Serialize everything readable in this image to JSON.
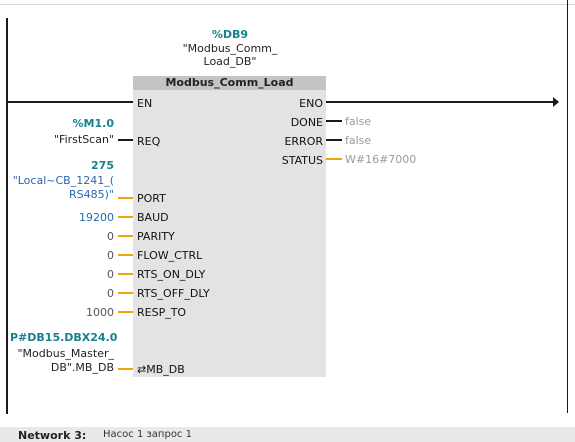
{
  "db": {
    "name": "%DB9",
    "symbol_line1": "\"Modbus_Comm_",
    "symbol_line2": "Load_DB\""
  },
  "block": {
    "title": "Modbus_Comm_Load"
  },
  "inputs": {
    "en": "EN",
    "req": "REQ",
    "port": "PORT",
    "baud": "BAUD",
    "parity": "PARITY",
    "flow_ctrl": "FLOW_CTRL",
    "rts_on_dly": "RTS_ON_DLY",
    "rts_off_dly": "RTS_OFF_DLY",
    "resp_to": "RESP_TO",
    "mb_db": "⇄MB_DB"
  },
  "outputs": {
    "eno": "ENO",
    "done": "DONE",
    "error": "ERROR",
    "status": "STATUS"
  },
  "params": {
    "req_var": "%M1.0",
    "req_sym": "\"FirstScan\"",
    "port_val": "275",
    "port_sym1": "\"Local~CB_1241_(",
    "port_sym2": "RS485)\"",
    "baud_val": "19200",
    "parity_val": "0",
    "flow_val": "0",
    "rts_on_val": "0",
    "rts_off_val": "0",
    "resp_val": "1000",
    "mbdb_var": "P#DB15.DBX24.0",
    "mbdb_sym1": "\"Modbus_Master_",
    "mbdb_sym2": "DB\".MB_DB"
  },
  "output_values": {
    "done": "false",
    "error": "false",
    "status": "W#16#7000"
  },
  "network": {
    "label": "Network 3:",
    "title": "Насос 1 запрос 1"
  },
  "colors": {
    "accent_teal": "#17818f",
    "wire_orange": "#f0a30a",
    "value_blue": "#2a67b1"
  }
}
